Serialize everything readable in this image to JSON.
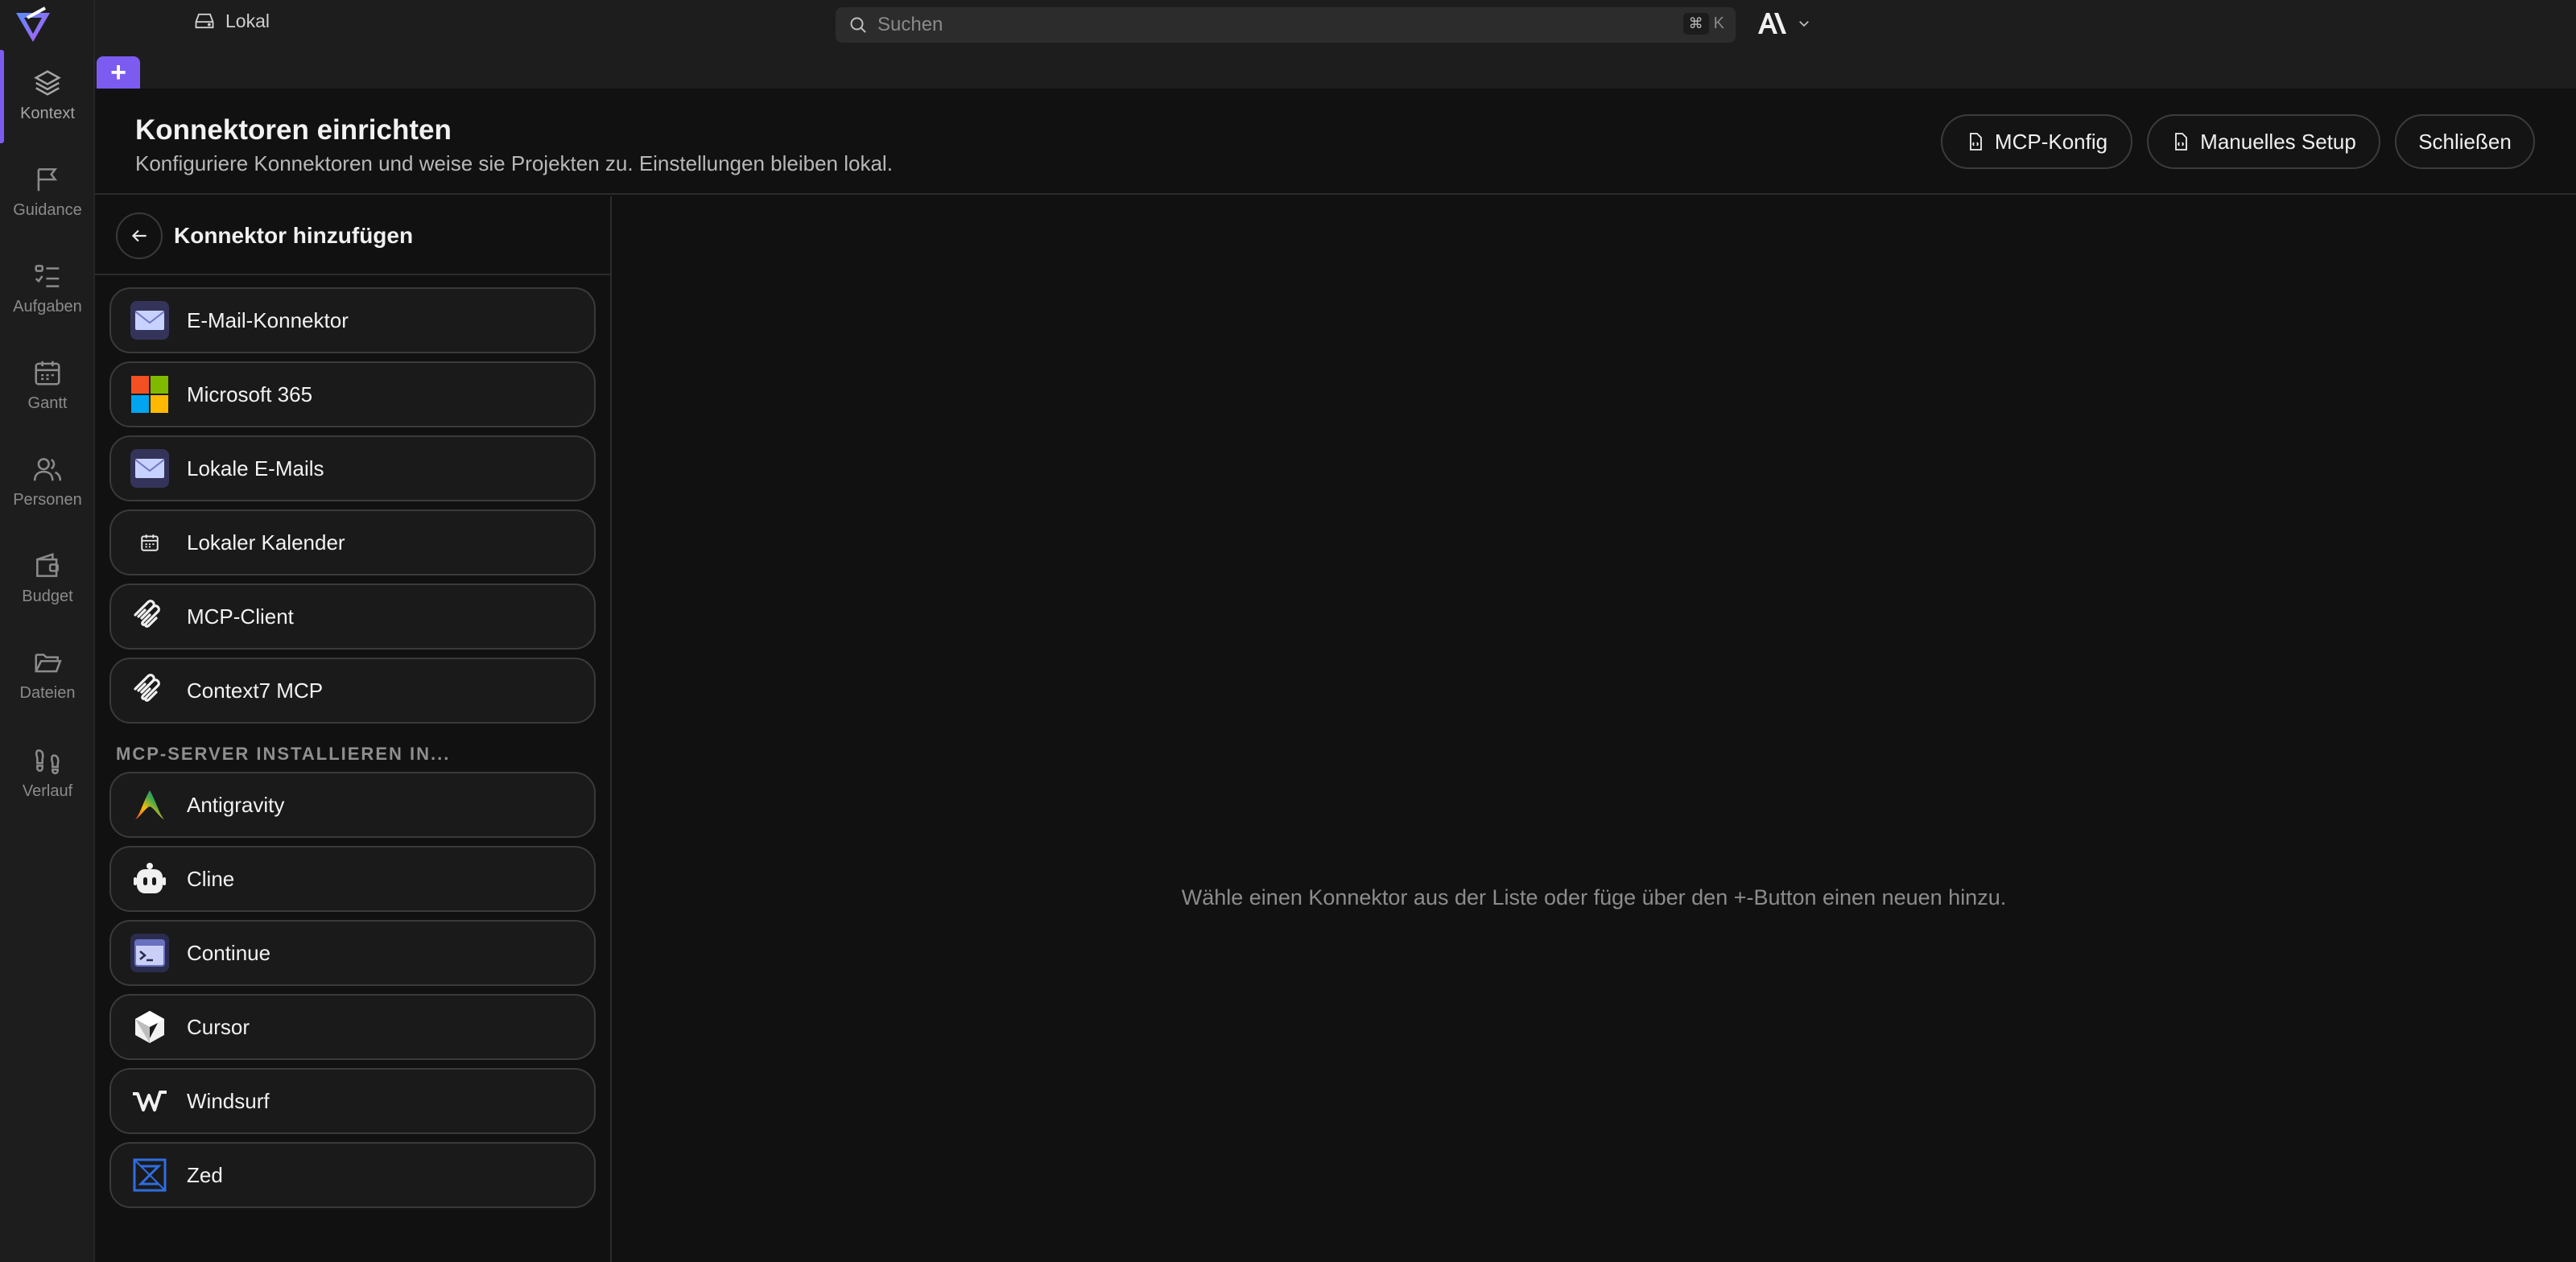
{
  "topbar": {
    "workspace": "Lokal",
    "search_placeholder": "Suchen",
    "shortcut_cmd": "⌘",
    "shortcut_key": "K",
    "brand_accent": "#7c5cf0"
  },
  "rail": {
    "items": [
      {
        "label": "Kontext",
        "icon": "layers-icon"
      },
      {
        "label": "Guidance",
        "icon": "flag-icon"
      },
      {
        "label": "Aufgaben",
        "icon": "checklist-icon"
      },
      {
        "label": "Gantt",
        "icon": "calendar-icon"
      },
      {
        "label": "Personen",
        "icon": "people-icon"
      },
      {
        "label": "Budget",
        "icon": "wallet-icon"
      },
      {
        "label": "Dateien",
        "icon": "folder-icon"
      },
      {
        "label": "Verlauf",
        "icon": "footsteps-icon"
      }
    ]
  },
  "tabs": {
    "add_label": "+"
  },
  "header": {
    "title": "Konnektoren einrichten",
    "subtitle": "Konfiguriere Konnektoren und weise sie Projekten zu. Einstellungen bleiben lokal.",
    "buttons": {
      "mcp_config": "MCP-Konfig",
      "manual_setup": "Manuelles Setup",
      "close": "Schließen"
    }
  },
  "panel": {
    "title": "Konnektor hinzufügen",
    "connectors": [
      {
        "name": "E-Mail-Konnektor",
        "icon": "mail-icon"
      },
      {
        "name": "Microsoft 365",
        "icon": "microsoft-icon"
      },
      {
        "name": "Lokale E-Mails",
        "icon": "mail-icon"
      },
      {
        "name": "Lokaler Kalender",
        "icon": "calendar-icon"
      },
      {
        "name": "MCP-Client",
        "icon": "mcp-icon"
      },
      {
        "name": "Context7 MCP",
        "icon": "mcp-icon"
      }
    ],
    "section_label": "MCP-SERVER INSTALLIEREN IN...",
    "servers": [
      {
        "name": "Antigravity",
        "icon": "antigravity-icon"
      },
      {
        "name": "Cline",
        "icon": "cline-icon"
      },
      {
        "name": "Continue",
        "icon": "continue-icon"
      },
      {
        "name": "Cursor",
        "icon": "cursor-icon"
      },
      {
        "name": "Windsurf",
        "icon": "windsurf-icon"
      },
      {
        "name": "Zed",
        "icon": "zed-icon"
      }
    ]
  },
  "main": {
    "empty_message": "Wähle einen Konnektor aus der Liste oder füge über den +-Button einen neuen hinzu."
  }
}
